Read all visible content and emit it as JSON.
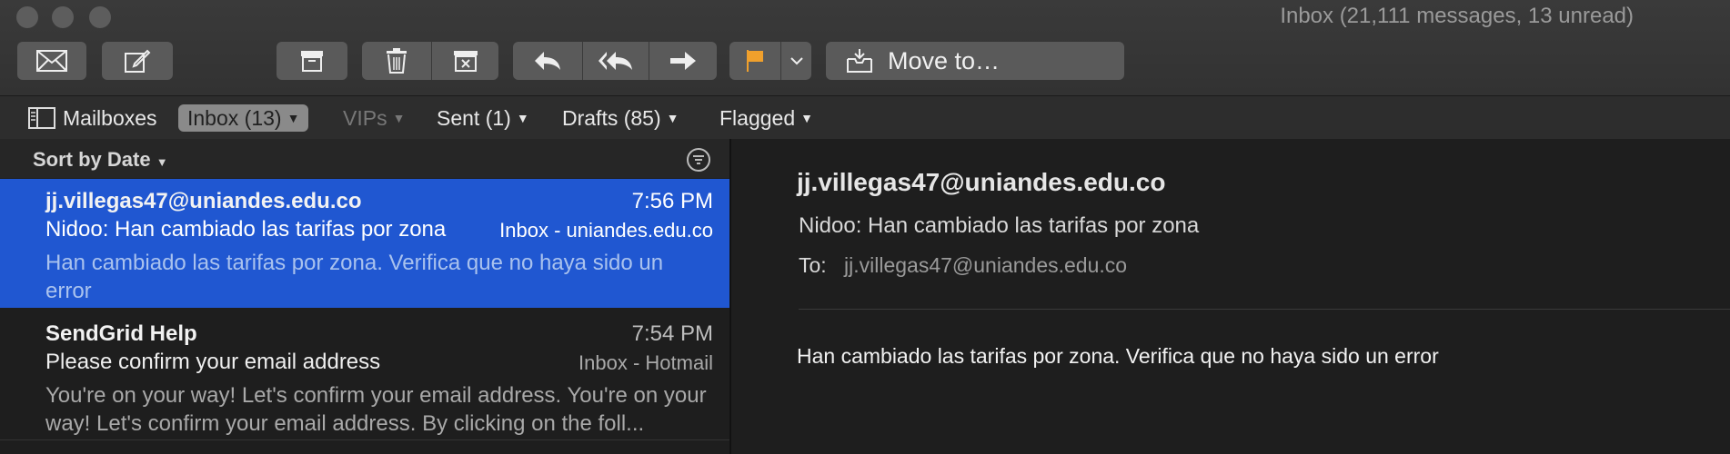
{
  "window": {
    "title": "Inbox (21,111 messages, 13 unread)"
  },
  "toolbar": {
    "move_to_label": "Move to…",
    "flag_color": "#f0a02c"
  },
  "favorites": {
    "mailboxes_label": "Mailboxes",
    "items": [
      {
        "label": "Inbox (13)",
        "selected": true
      },
      {
        "label": "VIPs",
        "dimmed": true
      },
      {
        "label": "Sent (1)"
      },
      {
        "label": "Drafts (85)"
      },
      {
        "label": "Flagged"
      }
    ]
  },
  "list": {
    "sort_label": "Sort by Date",
    "messages": [
      {
        "from": "jj.villegas47@uniandes.edu.co",
        "time": "7:56 PM",
        "subject": "Nidoo: Han cambiado las tarifas por zona",
        "mailbox": "Inbox - uniandes.edu.co",
        "preview": "Han cambiado las tarifas por zona. Verifica que no haya sido un error",
        "selected": true
      },
      {
        "from": "SendGrid Help",
        "time": "7:54 PM",
        "subject": "Please confirm your email address",
        "mailbox": "Inbox - Hotmail",
        "preview": "You're on your way! Let's confirm your email address. You're on your way! Let's confirm your email address. By clicking on the foll..."
      }
    ]
  },
  "reader": {
    "from": "jj.villegas47@uniandes.edu.co",
    "subject": "Nidoo: Han cambiado las tarifas por zona",
    "to_label": "To:",
    "to": "jj.villegas47@uniandes.edu.co",
    "body": "Han cambiado las tarifas por zona. Verifica que no haya sido un error"
  }
}
